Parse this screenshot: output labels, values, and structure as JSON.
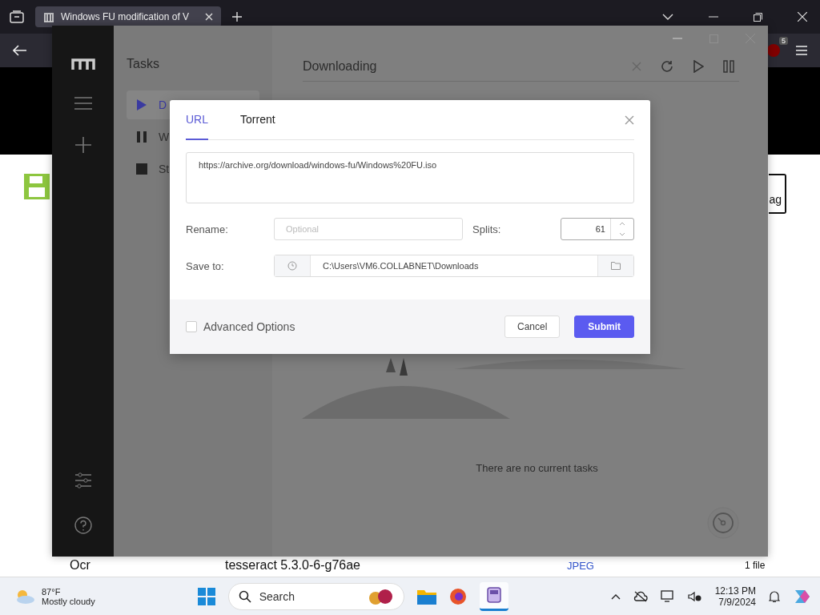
{
  "browser": {
    "tab_title": "Windows FU modification of V",
    "badge_count": "5"
  },
  "page": {
    "partial_button": "ag",
    "row": {
      "label": "Ocr",
      "value": "tesseract 5.3.0-6-g76ae",
      "format": "JPEG",
      "count": "1 file"
    }
  },
  "app": {
    "list_title": "Tasks",
    "task_lists": [
      {
        "label": "D",
        "kind": "active",
        "selected": true
      },
      {
        "label": "W",
        "kind": "waiting",
        "selected": false
      },
      {
        "label": "St",
        "kind": "stopped",
        "selected": false
      }
    ],
    "main_title": "Downloading",
    "empty_message": "There are no current tasks"
  },
  "dialog": {
    "tabs": [
      {
        "label": "URL",
        "selected": true
      },
      {
        "label": "Torrent",
        "selected": false
      }
    ],
    "url": "https://archive.org/download/windows-fu/Windows%20FU.iso",
    "rename": {
      "label": "Rename:",
      "placeholder": "Optional"
    },
    "splits": {
      "label": "Splits:",
      "value": "61"
    },
    "save_to": {
      "label": "Save to:",
      "value": "C:\\Users\\VM6.COLLABNET\\Downloads"
    },
    "advanced": {
      "label": "Advanced Options",
      "checked": false
    },
    "buttons": [
      {
        "label": "Cancel",
        "kind": "secondary"
      },
      {
        "label": "Submit",
        "kind": "primary"
      }
    ]
  },
  "taskbar": {
    "temperature": "87°F",
    "weather": "Mostly cloudy",
    "search_placeholder": "Search",
    "time": "12:13 PM",
    "date": "7/9/2024"
  }
}
